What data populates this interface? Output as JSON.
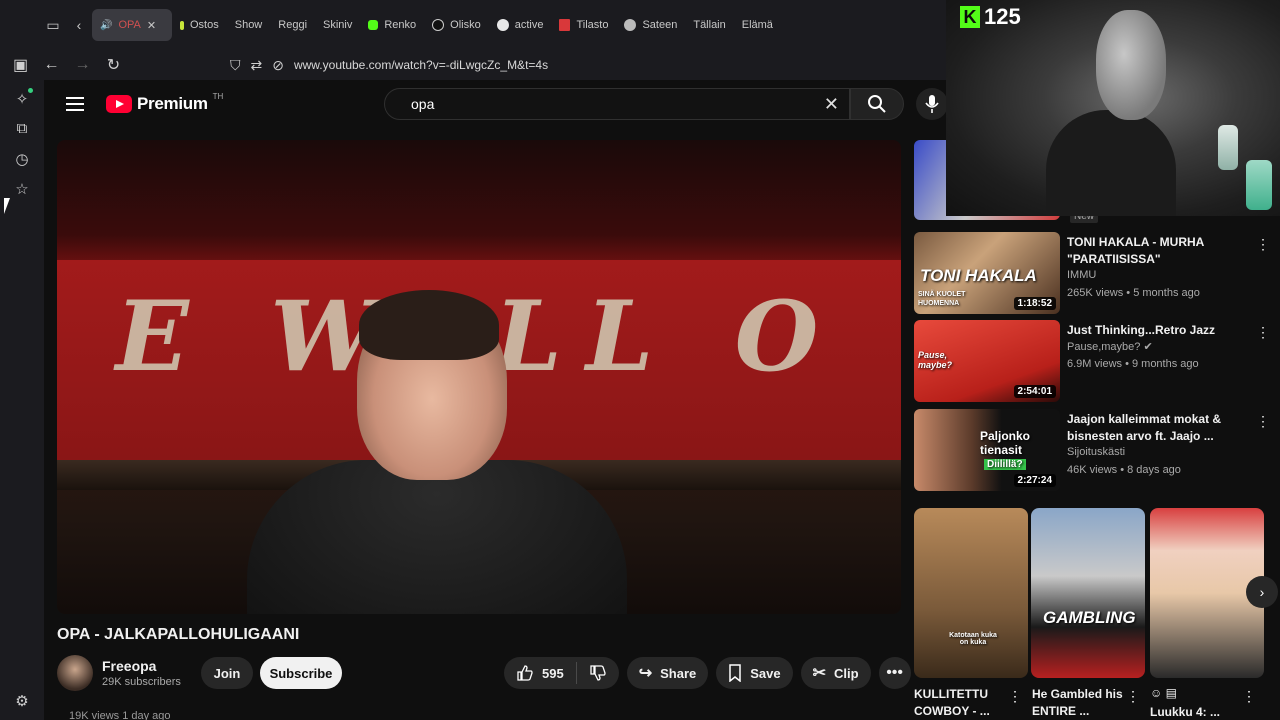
{
  "browser": {
    "tabs": [
      {
        "label": "OPA",
        "favicon": "youtube-favicon",
        "active": true
      },
      {
        "label": "Ostos",
        "favicon": "bolt-favicon"
      },
      {
        "label": "Show",
        "favicon": "youtube-favicon"
      },
      {
        "label": "Reggi",
        "favicon": "youtube-favicon"
      },
      {
        "label": "Skiniv",
        "favicon": "youtube-favicon"
      },
      {
        "label": "Renko",
        "favicon": "kick-favicon"
      },
      {
        "label": "Olisko",
        "favicon": "tiktok-favicon"
      },
      {
        "label": "active",
        "favicon": "google-favicon"
      },
      {
        "label": "Tilasto",
        "favicon": "tilasto-favicon"
      },
      {
        "label": "Sateen",
        "favicon": "cloud-favicon"
      },
      {
        "label": "Tällain",
        "favicon": "youtube-favicon"
      },
      {
        "label": "Elämä",
        "favicon": "youtube-favicon"
      }
    ],
    "url": "www.youtube.com/watch?v=-diLwgcZc_M&t=4s"
  },
  "youtube": {
    "logo_text": "Premium",
    "logo_sup": "TH",
    "search_value": "opa",
    "video": {
      "title": "OPA - JALKAPALLOHULIGAANI",
      "sign_text": "E WALL O",
      "channel": "Freeopa",
      "subscribers": "29K subscribers",
      "join_label": "Join",
      "subscribe_label": "Subscribe",
      "likes": "595",
      "share_label": "Share",
      "save_label": "Save",
      "clip_label": "Clip",
      "views_line": "19K views  1 day ago"
    },
    "new_badge": "New",
    "recommendations": [
      {
        "title": "TONI HAKALA - MURHA \"PARATIISISSA\"",
        "channel": "IMMU",
        "meta": "265K views • 5 months ago",
        "duration": "1:18:52",
        "thumb_text": "TONI HAKALA",
        "thumb_sub": "SINÄ KUOLET HUOMENNA"
      },
      {
        "title": "Just Thinking...Retro Jazz",
        "channel": "Pause,maybe?",
        "meta": "6.9M views • 9 months ago",
        "duration": "2:54:01",
        "thumb_text": "Pause, maybe?"
      },
      {
        "title": "Jaajon kalleimmat mokat & bisnesten arvo ft. Jaajo ...",
        "channel": "Sijoituskästi",
        "meta": "46K views • 8 days ago",
        "duration": "2:27:24",
        "thumb_text": "Paljonko tienasit",
        "thumb_sub": "Diilillä?"
      }
    ],
    "shorts": [
      {
        "title": "KULLITETTU COWBOY - ...",
        "overlay": "Katotaan kuka on kuka"
      },
      {
        "title": "He Gambled his ENTIRE ...",
        "overlay": "GAMBLING"
      },
      {
        "title": "Luukku 4: ...",
        "overlay": ""
      }
    ]
  },
  "stream": {
    "kick_count": "125",
    "kick_letter": "K"
  },
  "colors": {
    "youtube_red": "#ff0033",
    "kick_green": "#53fc18",
    "background": "#0f0f0f"
  }
}
